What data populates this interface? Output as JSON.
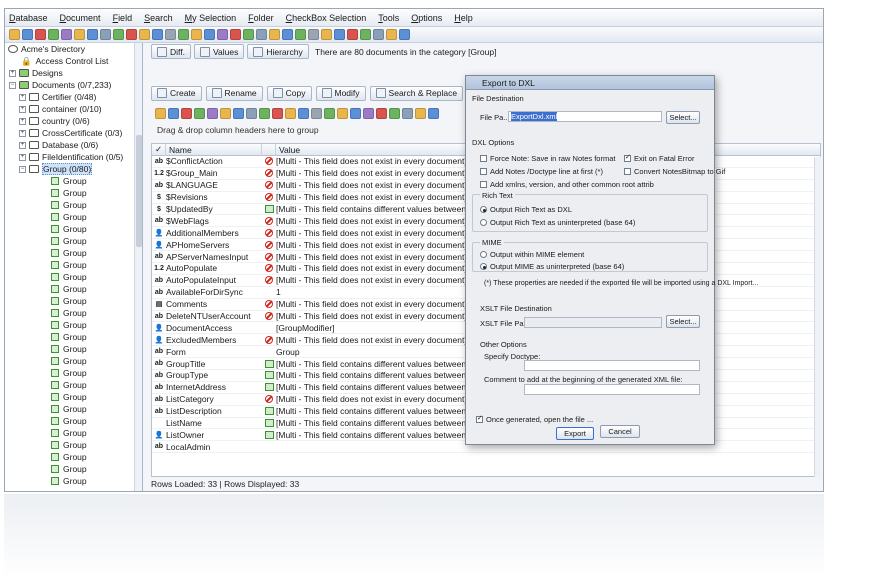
{
  "menu": [
    "Database",
    "Document",
    "Field",
    "Search",
    "My Selection",
    "Folder",
    "CheckBox Selection",
    "Tools",
    "Options",
    "Help"
  ],
  "tree": {
    "root": "Acme's Directory",
    "acl": "Access Control List",
    "designs": "Designs",
    "documents": "Documents  (0/7,233)",
    "folders": [
      "Certifier  (0/48)",
      "container  (0/10)",
      "country  (0/6)",
      "CrossCertificate  (0/3)",
      "Database  (0/6)",
      "FileIdentification  (0/5)"
    ],
    "selected_folder": "Group  (0/80)",
    "group_item": "Group",
    "group_count": 26
  },
  "tabs": {
    "diff": "Diff.",
    "values": "Values",
    "hierarchy": "Hierarchy"
  },
  "info": "There are 80 documents in the category [Group]",
  "actions": [
    "Create",
    "Rename",
    "Copy",
    "Modify",
    "Search & Replace"
  ],
  "group_hint": "Drag & drop column headers here to group",
  "columns": {
    "name": "Name",
    "value": "Value"
  },
  "rows": [
    {
      "icon": "ab",
      "name": "$ConflictAction",
      "status": "no",
      "value": "[Multi - This field does not exist in every document]"
    },
    {
      "icon": "1.2",
      "name": "$Group_Main",
      "status": "no",
      "value": "[Multi - This field does not exist in every document]"
    },
    {
      "icon": "ab",
      "name": "$LANGUAGE",
      "status": "no",
      "value": "[Multi - This field does not exist in every document]"
    },
    {
      "icon": "$",
      "name": "$Revisions",
      "status": "no",
      "value": "[Multi - This field does not exist in every document]"
    },
    {
      "icon": "$",
      "name": "$UpdatedBy",
      "status": "diff",
      "value": "[Multi - This field contains different values between documents]"
    },
    {
      "icon": "ab",
      "name": "$WebFlags",
      "status": "no",
      "value": "[Multi - This field does not exist in every document]"
    },
    {
      "icon": "👤",
      "name": "AdditionalMembers",
      "status": "no",
      "value": "[Multi - This field does not exist in every document]"
    },
    {
      "icon": "👤",
      "name": "APHomeServers",
      "status": "no",
      "value": "[Multi - This field does not exist in every document]"
    },
    {
      "icon": "ab",
      "name": "APServerNamesInput",
      "status": "no",
      "value": "[Multi - This field does not exist in every document]"
    },
    {
      "icon": "1.2",
      "name": "AutoPopulate",
      "status": "no",
      "value": "[Multi - This field does not exist in every document]"
    },
    {
      "icon": "ab",
      "name": "AutoPopulateInput",
      "status": "no",
      "value": "[Multi - This field does not exist in every document]"
    },
    {
      "icon": "ab",
      "name": "AvailableForDirSync",
      "status": "",
      "value": "1"
    },
    {
      "icon": "▤",
      "name": "Comments",
      "status": "no",
      "value": "[Multi - This field does not exist in every document]"
    },
    {
      "icon": "ab",
      "name": "DeleteNTUserAccount",
      "status": "no",
      "value": "[Multi - This field does not exist in every document]"
    },
    {
      "icon": "👤",
      "name": "DocumentAccess",
      "status": "",
      "value": "[GroupModifier]"
    },
    {
      "icon": "👤",
      "name": "ExcludedMembers",
      "status": "no",
      "value": "[Multi - This field does not exist in every document]"
    },
    {
      "icon": "ab",
      "name": "Form",
      "status": "",
      "value": "Group"
    },
    {
      "icon": "ab",
      "name": "GroupTitle",
      "status": "diff",
      "value": "[Multi - This field contains different values between documents]"
    },
    {
      "icon": "ab",
      "name": "GroupType",
      "status": "diff",
      "value": "[Multi - This field contains different values between documents]"
    },
    {
      "icon": "ab",
      "name": "InternetAddress",
      "status": "diff",
      "value": "[Multi - This field contains different values between documents]"
    },
    {
      "icon": "ab",
      "name": "ListCategory",
      "status": "no",
      "value": "[Multi - This field does not exist in every document]"
    },
    {
      "icon": "ab",
      "name": "ListDescription",
      "status": "diff",
      "value": "[Multi - This field contains different values between documents]"
    },
    {
      "icon": "",
      "name": "ListName",
      "status": "diff",
      "value": "[Multi - This field contains different values between documents]"
    },
    {
      "icon": "👤",
      "name": "ListOwner",
      "status": "diff",
      "value": "[Multi - This field contains different values between documents]"
    },
    {
      "icon": "ab",
      "name": "LocalAdmin",
      "status": "",
      "value": ""
    }
  ],
  "status": "Rows Loaded: 33  |  Rows Displayed: 33",
  "dialog": {
    "title": "Export to DXL",
    "file_dest": "File Destination",
    "file_path_label": "File Pa...",
    "file_path": "ExportDxl.xml",
    "select": "Select...",
    "dxl_options": "DXL Options",
    "force_note": "Force Note: Save in raw Notes format",
    "exit_fatal": "Exit on Fatal Error",
    "add_notes": "Add Notes /Doctype line at first (*)",
    "convert_bitmap": "Convert NotesBitmap to Gif",
    "add_xmlns": "Add xmlns, version, and other common root attrib",
    "rich_text": "Rich Text",
    "rt_dxl": "Output Rich Text as DXL",
    "rt_uninterp": "Output Rich Text as uninterpreted (base 64)",
    "mime": "MIME",
    "mime_within": "Output within MIME element",
    "mime_uninterp": "Output MIME as uninterpreted (base 64)",
    "note": "(*) These properties are needed if the exported file will be imported using a DXL Import...",
    "xslt_dest": "XSLT File Destination",
    "xslt_path_label": "XSLT File Pa...",
    "xslt_select": "Select...",
    "other": "Other Options",
    "doctype": "Specify Doctype:",
    "comment": "Comment to add at the beginning of the generated XML file:",
    "open_after": "Once generated, open the file ...",
    "export": "Export",
    "cancel": "Cancel"
  }
}
